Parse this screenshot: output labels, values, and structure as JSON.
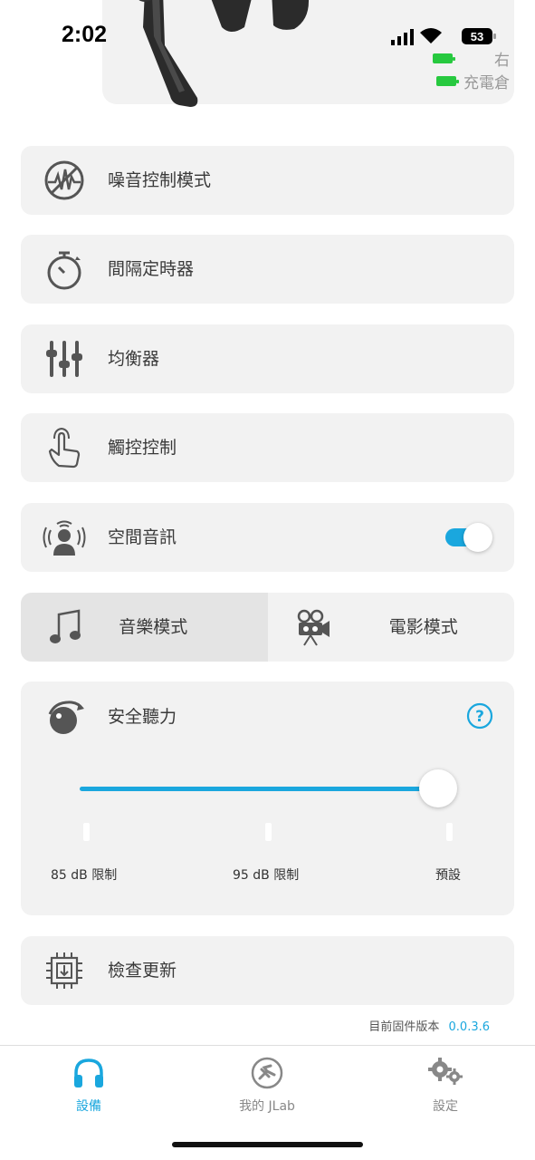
{
  "status_bar": {
    "time": "2:02",
    "battery_level": "53"
  },
  "device": {
    "battery_rows": [
      {
        "label": "右",
        "color": "#27c93f"
      },
      {
        "label": "充電倉",
        "color": "#27c93f"
      }
    ]
  },
  "menu": {
    "noise_control": "噪音控制模式",
    "interval_timer": "間隔定時器",
    "equalizer": "均衡器",
    "touch_control": "觸控控制",
    "spatial_audio": "空間音訊",
    "spatial_audio_on": true
  },
  "mode_segment": {
    "music": "音樂模式",
    "movie": "電影模式",
    "selected": "music"
  },
  "safe_listening": {
    "title": "安全聽力",
    "options": [
      "85 dB 限制",
      "95 dB 限制",
      "預設"
    ],
    "selected_index": 2
  },
  "check_update": "檢查更新",
  "firmware": {
    "label": "目前固件版本",
    "version": "0.0.3.6"
  },
  "tabs": [
    {
      "label": "設備",
      "icon": "headphones-icon",
      "active": true
    },
    {
      "label": "我的 JLab",
      "icon": "jlab-logo-icon",
      "active": false
    },
    {
      "label": "設定",
      "icon": "gears-icon",
      "active": false
    }
  ],
  "colors": {
    "accent": "#1aa7de",
    "battery": "#27c93f",
    "card": "#f2f2f2"
  }
}
